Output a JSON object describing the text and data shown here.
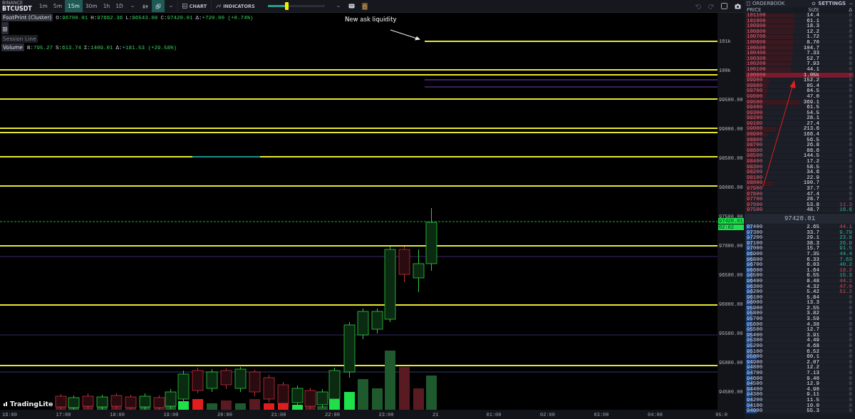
{
  "toolbar": {
    "exchange": "BINANCE",
    "symbol": "BTCUSDT",
    "timeframes": [
      {
        "label": "1m",
        "selected": false
      },
      {
        "label": "5m",
        "selected": false
      },
      {
        "label": "15m",
        "selected": true
      },
      {
        "label": "30m",
        "selected": false
      },
      {
        "label": "1h",
        "selected": false
      },
      {
        "label": "1D",
        "selected": false
      }
    ],
    "chart_button": "CHART",
    "indicators_button": "INDICATORS",
    "slider": {
      "level": 0.33
    }
  },
  "chart": {
    "annotation": "New ask liquidity",
    "logo": "TradingLite",
    "indicators": [
      {
        "name": "FootPrint (Cluster)",
        "hidden": false,
        "values": [
          {
            "label": "O:",
            "value": "96700.01"
          },
          {
            "label": "H:",
            "value": "97662.36"
          },
          {
            "label": "L:",
            "value": "96543.08"
          },
          {
            "label": "C:",
            "value": "97420.01"
          },
          {
            "label": "Δ:",
            "value": "+720.00 (+0.74%)"
          }
        ]
      },
      {
        "name": "Session Line",
        "hidden": true
      },
      {
        "name": "Volume",
        "hidden": false,
        "values": [
          {
            "label": "B:",
            "value": "795.27"
          },
          {
            "label": "S:",
            "value": "613.74"
          },
          {
            "label": "Σ:",
            "value": "1409.01"
          },
          {
            "label": "Δ:",
            "value": "+181.53 (+29.58%)"
          }
        ]
      }
    ]
  },
  "price_axis": {
    "labels": [
      "101k",
      "100k",
      "99500.00",
      "99000.00",
      "98500.00",
      "98000.00",
      "97500.00",
      "97000.00",
      "96500.00",
      "96000.00",
      "95500.00",
      "95000.00",
      "94500.00"
    ],
    "last_price": "97420.01",
    "countdown": "02:02"
  },
  "time_axis": [
    "16:00",
    "17:00",
    "18:00",
    "19:00",
    "20:00",
    "21:00",
    "22:00",
    "23:00",
    "21",
    "01:00",
    "02:00",
    "03:00",
    "04:00",
    "05:0"
  ],
  "orderbook": {
    "title": "ORDERBOOK",
    "settings": "SETTINGS",
    "columns": [
      "PRICE",
      "SIZE",
      "Δ"
    ],
    "asks": [
      {
        "price": "101100",
        "size": "14.4",
        "delta": "0",
        "kind": "neutral",
        "level": 0.45,
        "highlighted": false
      },
      {
        "price": "101000",
        "size": "61.1",
        "delta": "0",
        "kind": "neutral",
        "level": 0.45,
        "highlighted": false
      },
      {
        "price": "100900",
        "size": "18.3",
        "delta": "0",
        "kind": "neutral",
        "level": 0.45,
        "highlighted": false
      },
      {
        "price": "100800",
        "size": "12.2",
        "delta": "0",
        "kind": "neutral",
        "level": 0.44,
        "highlighted": false
      },
      {
        "price": "100700",
        "size": "1.72",
        "delta": "0",
        "kind": "neutral",
        "level": 0.44,
        "highlighted": false
      },
      {
        "price": "100600",
        "size": "8.70",
        "delta": "0",
        "kind": "neutral",
        "level": 0.44,
        "highlighted": false
      },
      {
        "price": "100500",
        "size": "104.7",
        "delta": "0",
        "kind": "neutral",
        "level": 0.44,
        "highlighted": false
      },
      {
        "price": "100400",
        "size": "7.33",
        "delta": "0",
        "kind": "neutral",
        "level": 0.43,
        "highlighted": false
      },
      {
        "price": "100300",
        "size": "52.7",
        "delta": "0",
        "kind": "neutral",
        "level": 0.43,
        "highlighted": false
      },
      {
        "price": "100200",
        "size": "7.93",
        "delta": "0",
        "kind": "neutral",
        "level": 0.42,
        "highlighted": false
      },
      {
        "price": "100100",
        "size": "44.1",
        "delta": "0",
        "kind": "neutral",
        "level": 0.42,
        "highlighted": false
      },
      {
        "price": "100000",
        "size": "1.05k",
        "delta": "0",
        "kind": "neutral",
        "level": 1,
        "highlighted": true
      },
      {
        "price": "99900",
        "size": "152.2",
        "delta": "0",
        "kind": "neutral",
        "level": 0.22,
        "highlighted": false
      },
      {
        "price": "99800",
        "size": "85.4",
        "delta": "0",
        "kind": "neutral",
        "level": 0.2,
        "highlighted": false
      },
      {
        "price": "99700",
        "size": "84.5",
        "delta": "0",
        "kind": "neutral",
        "level": 0.2,
        "highlighted": false
      },
      {
        "price": "99600",
        "size": "47.0",
        "delta": "0",
        "kind": "neutral",
        "level": 0.18,
        "highlighted": false
      },
      {
        "price": "99500",
        "size": "369.1",
        "delta": "0",
        "kind": "neutral",
        "level": 0.5,
        "highlighted": false
      },
      {
        "price": "99400",
        "size": "61.5",
        "delta": "0",
        "kind": "neutral",
        "level": 0.16,
        "highlighted": false
      },
      {
        "price": "99300",
        "size": "54.5",
        "delta": "0",
        "kind": "neutral",
        "level": 0.16,
        "highlighted": false
      },
      {
        "price": "99200",
        "size": "28.1",
        "delta": "0",
        "kind": "neutral",
        "level": 0.15,
        "highlighted": false
      },
      {
        "price": "99100",
        "size": "27.4",
        "delta": "0",
        "kind": "neutral",
        "level": 0.13,
        "highlighted": false
      },
      {
        "price": "99000",
        "size": "213.6",
        "delta": "0",
        "kind": "neutral",
        "level": 0.28,
        "highlighted": false
      },
      {
        "price": "98900",
        "size": "166.4",
        "delta": "0",
        "kind": "neutral",
        "level": 0.2,
        "highlighted": false
      },
      {
        "price": "98800",
        "size": "56.5",
        "delta": "0",
        "kind": "neutral",
        "level": 0.1,
        "highlighted": false
      },
      {
        "price": "98700",
        "size": "26.8",
        "delta": "0",
        "kind": "neutral",
        "level": 0.09,
        "highlighted": false
      },
      {
        "price": "98600",
        "size": "88.6",
        "delta": "0",
        "kind": "neutral",
        "level": 0.1,
        "highlighted": false
      },
      {
        "price": "98500",
        "size": "144.5",
        "delta": "0",
        "kind": "neutral",
        "level": 0.1,
        "highlighted": false
      },
      {
        "price": "98400",
        "size": "17.2",
        "delta": "0",
        "kind": "neutral",
        "level": 0.09,
        "highlighted": false
      },
      {
        "price": "98300",
        "size": "58.5",
        "delta": "0",
        "kind": "neutral",
        "level": 0.09,
        "highlighted": false
      },
      {
        "price": "98200",
        "size": "34.6",
        "delta": "0",
        "kind": "neutral",
        "level": 0.09,
        "highlighted": false
      },
      {
        "price": "98100",
        "size": "22.9",
        "delta": "0",
        "kind": "neutral",
        "level": 0.09,
        "highlighted": false
      },
      {
        "price": "98000",
        "size": "190.7",
        "delta": "0",
        "kind": "neutral",
        "level": 0.25,
        "highlighted": false
      },
      {
        "price": "97900",
        "size": "37.7",
        "delta": "0",
        "kind": "neutral",
        "level": 0.07,
        "highlighted": false
      },
      {
        "price": "97800",
        "size": "47.4",
        "delta": "0",
        "kind": "neutral",
        "level": 0.07,
        "highlighted": false
      },
      {
        "price": "97700",
        "size": "28.7",
        "delta": "0",
        "kind": "neutral",
        "level": 0.06,
        "highlighted": false
      },
      {
        "price": "97600",
        "size": "53.8",
        "delta": "11.3",
        "kind": "sell",
        "level": 0.05,
        "highlighted": false
      },
      {
        "price": "97500",
        "size": "48.7",
        "delta": "16.6",
        "kind": "buy",
        "level": 0.04,
        "highlighted": false
      }
    ],
    "mid_price": "97420.01",
    "bids": [
      {
        "price": "97400",
        "size": "2.65",
        "delta": "44.1",
        "kind": "sell",
        "level": 0.06
      },
      {
        "price": "97300",
        "size": "33.7",
        "delta": "9.79",
        "kind": "buy",
        "level": 0.06
      },
      {
        "price": "97200",
        "size": "29.1",
        "delta": "23.8",
        "kind": "buy",
        "level": 0.06
      },
      {
        "price": "97100",
        "size": "38.3",
        "delta": "26.9",
        "kind": "buy",
        "level": 0.06
      },
      {
        "price": "97000",
        "size": "15.7",
        "delta": "91.5",
        "kind": "buy",
        "level": 0.06
      },
      {
        "price": "96900",
        "size": "7.35",
        "delta": "44.4",
        "kind": "buy",
        "level": 0.06
      },
      {
        "price": "96800",
        "size": "6.33",
        "delta": "7.63",
        "kind": "buy",
        "level": 0.06
      },
      {
        "price": "96700",
        "size": "6.03",
        "delta": "40.2",
        "kind": "buy",
        "level": 0.06
      },
      {
        "price": "96600",
        "size": "1.64",
        "delta": "18.2",
        "kind": "sell",
        "level": 0.06
      },
      {
        "price": "96500",
        "size": "6.55",
        "delta": "15.3",
        "kind": "buy",
        "level": 0.06
      },
      {
        "price": "96400",
        "size": "8.48",
        "delta": "44.1",
        "kind": "sell",
        "level": 0.06
      },
      {
        "price": "96300",
        "size": "4.32",
        "delta": "47.0",
        "kind": "sell",
        "level": 0.06
      },
      {
        "price": "96200",
        "size": "5.42",
        "delta": "51.2",
        "kind": "sell",
        "level": 0.06
      },
      {
        "price": "96100",
        "size": "5.84",
        "delta": "0",
        "kind": "neutral",
        "level": 0.06
      },
      {
        "price": "96000",
        "size": "13.3",
        "delta": "0",
        "kind": "neutral",
        "level": 0.06
      },
      {
        "price": "95900",
        "size": "2.55",
        "delta": "0",
        "kind": "neutral",
        "level": 0.06
      },
      {
        "price": "95800",
        "size": "3.82",
        "delta": "0",
        "kind": "neutral",
        "level": 0.06
      },
      {
        "price": "95700",
        "size": "3.59",
        "delta": "0",
        "kind": "neutral",
        "level": 0.06
      },
      {
        "price": "95600",
        "size": "4.38",
        "delta": "0",
        "kind": "neutral",
        "level": 0.06
      },
      {
        "price": "95500",
        "size": "12.7",
        "delta": "0",
        "kind": "neutral",
        "level": 0.06
      },
      {
        "price": "95400",
        "size": "3.91",
        "delta": "0",
        "kind": "neutral",
        "level": 0.06
      },
      {
        "price": "95300",
        "size": "4.49",
        "delta": "0",
        "kind": "neutral",
        "level": 0.06
      },
      {
        "price": "95200",
        "size": "4.68",
        "delta": "0",
        "kind": "neutral",
        "level": 0.06
      },
      {
        "price": "95100",
        "size": "6.52",
        "delta": "0",
        "kind": "neutral",
        "level": 0.06
      },
      {
        "price": "95000",
        "size": "60.1",
        "delta": "0",
        "kind": "neutral",
        "level": 0.1
      },
      {
        "price": "94900",
        "size": "2.07",
        "delta": "0",
        "kind": "neutral",
        "level": 0.06
      },
      {
        "price": "94800",
        "size": "12.2",
        "delta": "0",
        "kind": "neutral",
        "level": 0.06
      },
      {
        "price": "94700",
        "size": "7.13",
        "delta": "0",
        "kind": "neutral",
        "level": 0.06
      },
      {
        "price": "94600",
        "size": "9.40",
        "delta": "0",
        "kind": "neutral",
        "level": 0.06
      },
      {
        "price": "94500",
        "size": "12.9",
        "delta": "0",
        "kind": "neutral",
        "level": 0.06
      },
      {
        "price": "94400",
        "size": "4.90",
        "delta": "0",
        "kind": "neutral",
        "level": 0.06
      },
      {
        "price": "94300",
        "size": "9.11",
        "delta": "0",
        "kind": "neutral",
        "level": 0.06
      },
      {
        "price": "94200",
        "size": "11.5",
        "delta": "0",
        "kind": "neutral",
        "level": 0.06
      },
      {
        "price": "94100",
        "size": "10.0",
        "delta": "0",
        "kind": "neutral",
        "level": 0.06
      },
      {
        "price": "94000",
        "size": "55.3",
        "delta": "0",
        "kind": "neutral",
        "level": 0.1
      }
    ]
  }
}
